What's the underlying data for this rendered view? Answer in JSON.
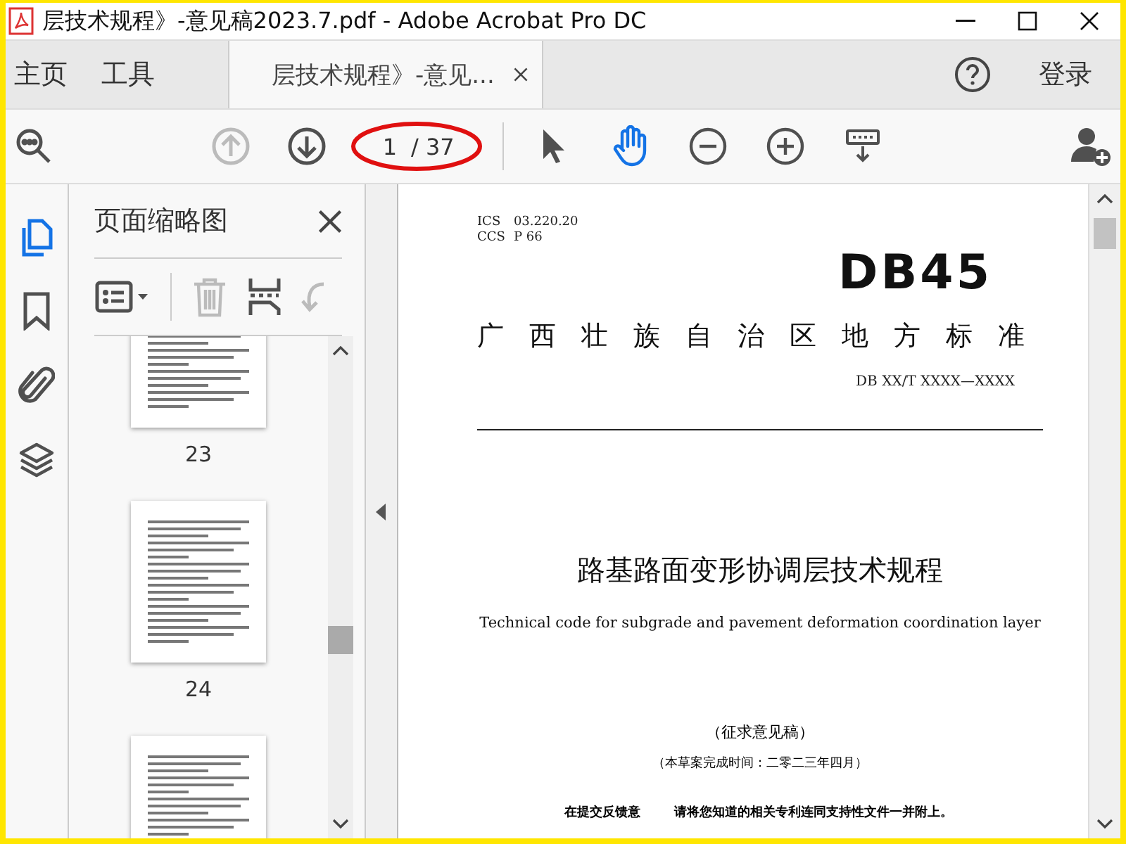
{
  "window": {
    "title": "层技术规程》-意见稿2023.7.pdf - Adobe Acrobat Pro DC"
  },
  "nav_tabs": [
    {
      "label": "主页",
      "selected": false
    },
    {
      "label": "工具",
      "selected": false
    },
    {
      "label": "层技术规程》-意见...",
      "selected": true
    }
  ],
  "sign_in": "登录",
  "toolbar": {
    "prev_disabled": true,
    "page_input": "1",
    "page_total": "/ 37",
    "tools": [
      {
        "kind": "pointer",
        "selected": false
      },
      {
        "kind": "hand",
        "selected": true
      },
      {
        "kind": "zoom-out",
        "selected": false
      },
      {
        "kind": "zoom-in",
        "selected": false
      },
      {
        "kind": "scroll-mode",
        "selected": false
      }
    ]
  },
  "side_rail": [
    {
      "kind": "pages",
      "selected": true
    },
    {
      "kind": "bookmark",
      "selected": false
    },
    {
      "kind": "attachment",
      "selected": false
    },
    {
      "kind": "layers",
      "selected": false
    }
  ],
  "thumbnail_panel": {
    "title": "页面缩略图",
    "tools": [
      {
        "kind": "options",
        "disabled": false
      },
      {
        "kind": "delete",
        "disabled": true
      },
      {
        "kind": "extract",
        "disabled": false
      },
      {
        "kind": "rotate",
        "disabled": true
      }
    ],
    "thumbnails": [
      {
        "label": "23",
        "selected": false
      },
      {
        "label": "24",
        "selected": false
      },
      {
        "selected": false
      }
    ]
  },
  "document": {
    "ics_label": "ICS",
    "ics": "03.220.20",
    "ccs_label": "CCS",
    "ccs": "P 66",
    "logo": "DB45",
    "issuer": "广西壮族自治区地方标准",
    "code": "DB XX/T XXXX—XXXX",
    "title": "路基路面变形协调层技术规程",
    "subtitle": "Technical code for subgrade and pavement deformation coordination layer",
    "stage": "（征求意见稿）",
    "draft_date": "（本草案完成时间：二零二三年四月）",
    "note_left": "在提交反馈意",
    "note_right": "请将您知道的相关专利连同支持性文件一并附上。"
  }
}
